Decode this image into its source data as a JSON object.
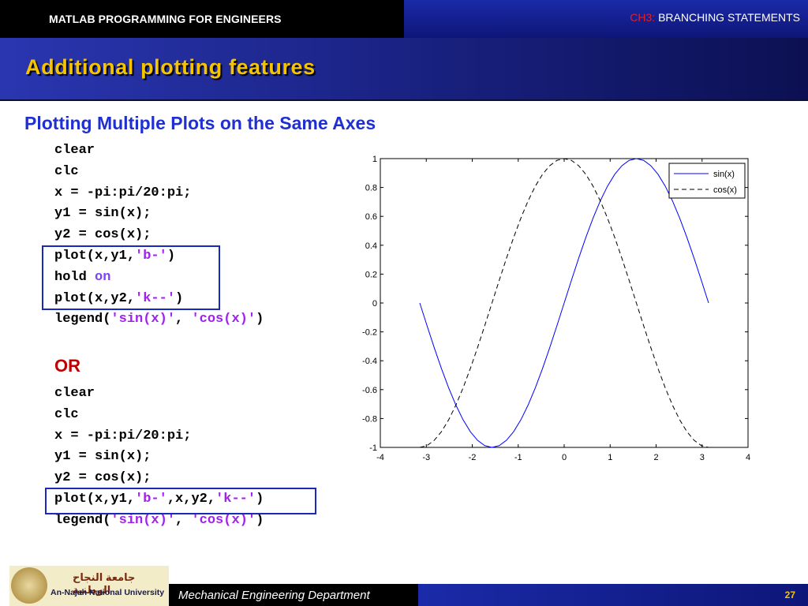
{
  "header": {
    "course_title": "MATLAB PROGRAMMING FOR ENGINEERS",
    "chapter_num": "CH3:",
    "chapter_title": "BRANCHING STATEMENTS"
  },
  "slide": {
    "title": "Additional plotting features",
    "subtitle": "Plotting Multiple Plots on the Same Axes",
    "or_label": "OR"
  },
  "code_block_1": [
    [
      {
        "t": "clear",
        "c": "plain"
      }
    ],
    [
      {
        "t": "clc",
        "c": "plain"
      }
    ],
    [
      {
        "t": "x = -pi:pi/20:pi;",
        "c": "plain"
      }
    ],
    [
      {
        "t": "y1 = sin(x);",
        "c": "plain"
      }
    ],
    [
      {
        "t": "y2 = cos(x);",
        "c": "plain"
      }
    ],
    [
      {
        "t": "plot(x,y1,",
        "c": "plain"
      },
      {
        "t": "'b-'",
        "c": "str"
      },
      {
        "t": ")",
        "c": "plain"
      }
    ],
    [
      {
        "t": "hold ",
        "c": "plain"
      },
      {
        "t": "on",
        "c": "kw"
      }
    ],
    [
      {
        "t": "plot(x,y2,",
        "c": "plain"
      },
      {
        "t": "'k--'",
        "c": "str"
      },
      {
        "t": ")",
        "c": "plain"
      }
    ],
    [
      {
        "t": "legend(",
        "c": "plain"
      },
      {
        "t": "'sin(x)'",
        "c": "str"
      },
      {
        "t": ", ",
        "c": "plain"
      },
      {
        "t": "'cos(x)'",
        "c": "str"
      },
      {
        "t": ")",
        "c": "plain"
      }
    ]
  ],
  "code_block_2": [
    [
      {
        "t": "clear",
        "c": "plain"
      }
    ],
    [
      {
        "t": "clc",
        "c": "plain"
      }
    ],
    [
      {
        "t": "x = -pi:pi/20:pi;",
        "c": "plain"
      }
    ],
    [
      {
        "t": "y1 = sin(x);",
        "c": "plain"
      }
    ],
    [
      {
        "t": "y2 = cos(x);",
        "c": "plain"
      }
    ],
    [
      {
        "t": "plot(x,y1,",
        "c": "plain"
      },
      {
        "t": "'b-'",
        "c": "str"
      },
      {
        "t": ",x,y2,",
        "c": "plain"
      },
      {
        "t": "'k--'",
        "c": "str"
      },
      {
        "t": ")",
        "c": "plain"
      }
    ],
    [
      {
        "t": "legend(",
        "c": "plain"
      },
      {
        "t": "'sin(x)'",
        "c": "str"
      },
      {
        "t": ", ",
        "c": "plain"
      },
      {
        "t": "'cos(x)'",
        "c": "str"
      },
      {
        "t": ")",
        "c": "plain"
      }
    ]
  ],
  "chart_data": {
    "type": "line",
    "title": "",
    "xlabel": "",
    "ylabel": "",
    "xlim": [
      -4,
      4
    ],
    "ylim": [
      -1,
      1
    ],
    "xticks": [
      -4,
      -3,
      -2,
      -1,
      0,
      1,
      2,
      3,
      4
    ],
    "yticks": [
      -1,
      -0.8,
      -0.6,
      -0.4,
      -0.2,
      0,
      0.2,
      0.4,
      0.6,
      0.8,
      1
    ],
    "x": [
      -3.1416,
      -2.9845,
      -2.8274,
      -2.6704,
      -2.5133,
      -2.3562,
      -2.1991,
      -2.042,
      -1.885,
      -1.7279,
      -1.5708,
      -1.4137,
      -1.2566,
      -1.0996,
      -0.9425,
      -0.7854,
      -0.6283,
      -0.4712,
      -0.3142,
      -0.1571,
      0.0,
      0.1571,
      0.3142,
      0.4712,
      0.6283,
      0.7854,
      0.9425,
      1.0996,
      1.2566,
      1.4137,
      1.5708,
      1.7279,
      1.885,
      2.042,
      2.1991,
      2.3562,
      2.5133,
      2.6704,
      2.8274,
      2.9845,
      3.1416
    ],
    "series": [
      {
        "name": "sin(x)",
        "color": "#0000ff",
        "style": "solid",
        "values": [
          0.0,
          -0.1564,
          -0.309,
          -0.454,
          -0.5878,
          -0.7071,
          -0.809,
          -0.891,
          -0.9511,
          -0.9877,
          -1.0,
          -0.9877,
          -0.9511,
          -0.891,
          -0.809,
          -0.7071,
          -0.5878,
          -0.454,
          -0.309,
          -0.1564,
          0.0,
          0.1564,
          0.309,
          0.454,
          0.5878,
          0.7071,
          0.809,
          0.891,
          0.9511,
          0.9877,
          1.0,
          0.9877,
          0.9511,
          0.891,
          0.809,
          0.7071,
          0.5878,
          0.454,
          0.309,
          0.1564,
          0.0
        ]
      },
      {
        "name": "cos(x)",
        "color": "#000000",
        "style": "dashed",
        "values": [
          -1.0,
          -0.9877,
          -0.9511,
          -0.891,
          -0.809,
          -0.7071,
          -0.5878,
          -0.454,
          -0.309,
          -0.1564,
          0.0,
          0.1564,
          0.309,
          0.454,
          0.5878,
          0.7071,
          0.809,
          0.891,
          0.9511,
          0.9877,
          1.0,
          0.9877,
          0.9511,
          0.891,
          0.809,
          0.7071,
          0.5878,
          0.454,
          0.309,
          0.1564,
          0.0,
          -0.1564,
          -0.309,
          -0.454,
          -0.5878,
          -0.7071,
          -0.809,
          -0.891,
          -0.9511,
          -0.9877,
          -1.0
        ]
      }
    ],
    "grid": false,
    "legend_position": "top-right"
  },
  "footer": {
    "university_ar": "جامعة النجاح الوطنية",
    "university_en": "An-Najah National University",
    "department": "Mechanical Engineering Department",
    "page_number": "27"
  }
}
